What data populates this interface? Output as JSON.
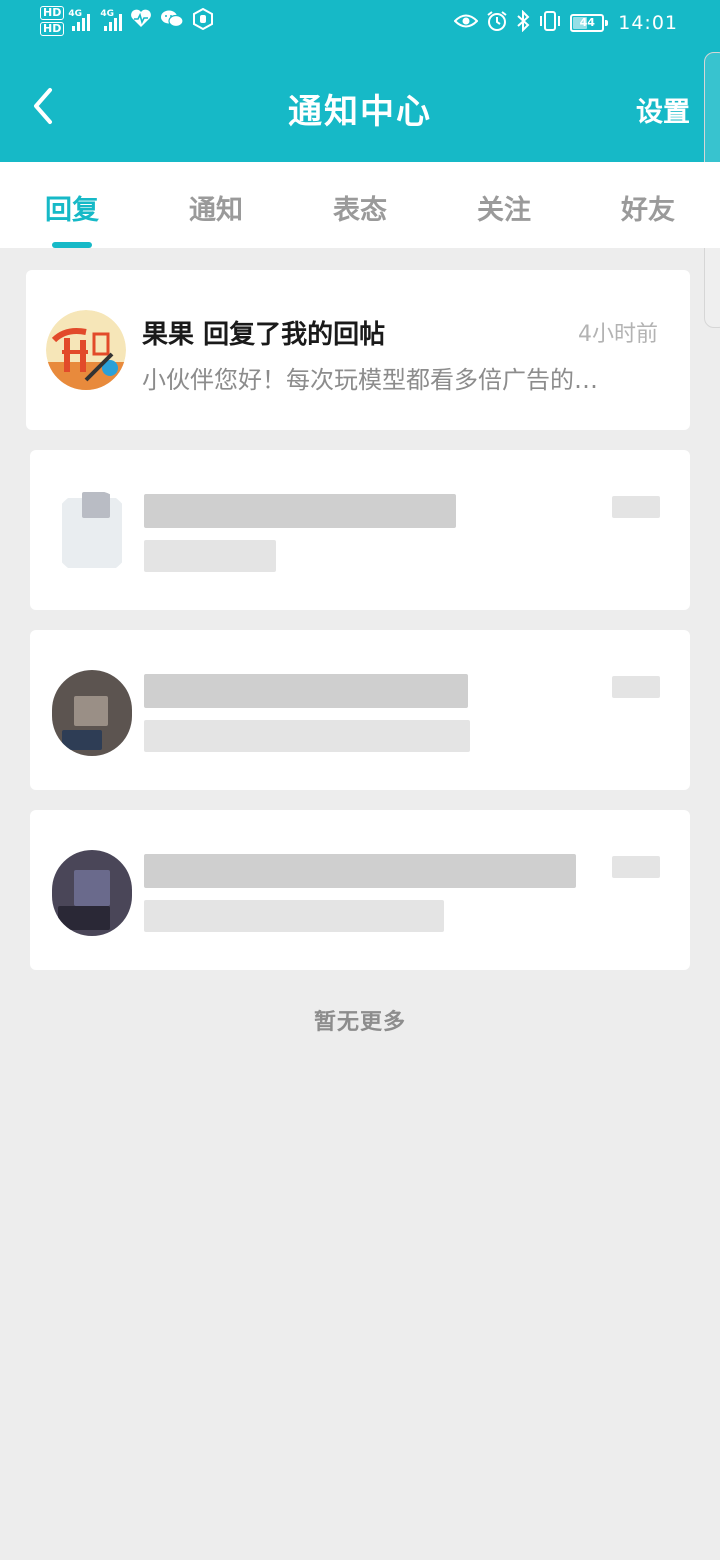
{
  "status_bar": {
    "hd1": "HD",
    "hd2": "HD",
    "sim1_label": "4G",
    "sim2_label": "4G",
    "battery": "44",
    "time": "14:01"
  },
  "header": {
    "title": "通知中心",
    "settings_label": "设置"
  },
  "tabs": [
    {
      "label": "回复",
      "active": true
    },
    {
      "label": "通知",
      "active": false
    },
    {
      "label": "表态",
      "active": false
    },
    {
      "label": "关注",
      "active": false
    },
    {
      "label": "好友",
      "active": false
    }
  ],
  "notifications": [
    {
      "sender": "果果",
      "action": "回复了我的回帖",
      "time": "4小时前",
      "preview": "小伙伴您好！每次玩模型都看多倍广告的…"
    }
  ],
  "footer": {
    "no_more": "暂无更多"
  },
  "colors": {
    "accent": "#16b9c7",
    "background": "#ededed"
  }
}
